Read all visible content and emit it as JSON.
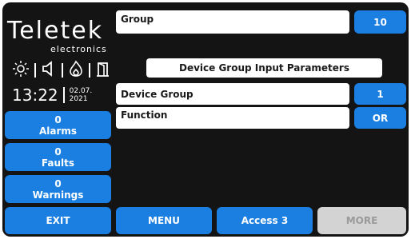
{
  "brand": {
    "logo": "Teletek",
    "subtitle": "electronics"
  },
  "status_icons": [
    "sun-icon",
    "speaker-icon",
    "flame-icon",
    "door-icon"
  ],
  "clock": {
    "time": "13:22",
    "date_line1": "02.07.",
    "date_line2": "2021"
  },
  "counters": [
    {
      "count": "0",
      "label": "Alarms"
    },
    {
      "count": "0",
      "label": "Faults"
    },
    {
      "count": "0",
      "label": "Warnings"
    }
  ],
  "group": {
    "label": "Group",
    "value": "10"
  },
  "section_title": "Device Group Input Parameters",
  "params": [
    {
      "label": "Device Group",
      "value": "1"
    },
    {
      "label": "Function",
      "value": "OR"
    }
  ],
  "footer": {
    "exit": "EXIT",
    "menu": "MENU",
    "access": "Access 3",
    "more": "MORE"
  },
  "colors": {
    "accent": "#1a7fe0",
    "background": "#141414",
    "disabled": "#d3d3d3"
  }
}
